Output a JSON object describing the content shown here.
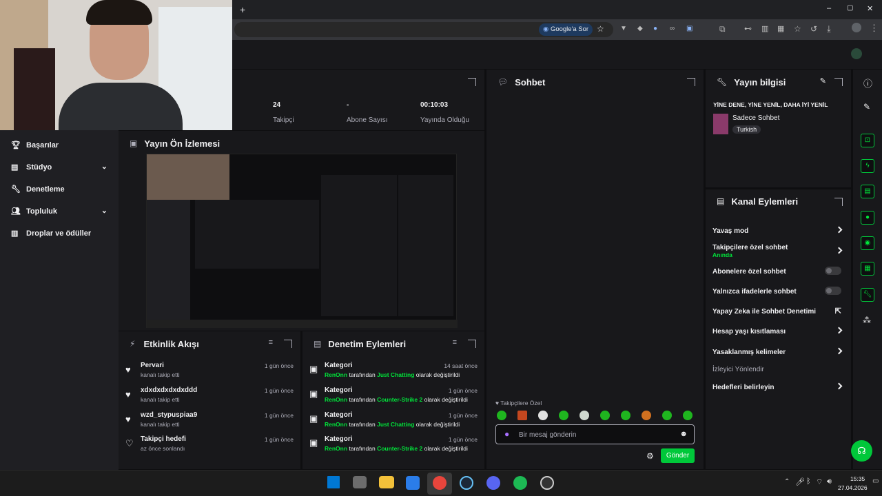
{
  "browser": {
    "new_tab": "+",
    "google_ask": "Google'a Sor",
    "win_min": "–",
    "win_max": "▢",
    "win_close": "✕"
  },
  "stats": {
    "followers_value": "24",
    "followers_label": "Takipçi",
    "subs_value": "-",
    "subs_label": "Abone Sayısı",
    "live_value": "00:10:03",
    "live_label": "Yayında Olduğu"
  },
  "nav": {
    "items": [
      {
        "label": "Başarılar",
        "icon": "trophy-icon"
      },
      {
        "label": "Stüdyo",
        "icon": "studio-icon",
        "expand": true
      },
      {
        "label": "Denetleme",
        "icon": "wrench-icon"
      },
      {
        "label": "Topluluk",
        "icon": "community-icon",
        "expand": true
      },
      {
        "label": "Droplar ve ödüller",
        "icon": "drops-icon"
      }
    ]
  },
  "preview": {
    "title": "Yayın Ön İzlemesi"
  },
  "activity": {
    "title": "Etkinlik Akışı",
    "items": [
      {
        "name": "Pervari",
        "sub": "kanalı takip etti",
        "when": "1 gün önce",
        "icon": "heart-icon"
      },
      {
        "name": "xdxdxdxdxdxddd",
        "sub": "kanalı takip etti",
        "when": "1 gün önce",
        "icon": "heart-icon"
      },
      {
        "name": "wzd_stypuspiaa9",
        "sub": "kanalı takip etti",
        "when": "1 gün önce",
        "icon": "heart-icon"
      },
      {
        "name": "Takipçi hedefi",
        "sub": "az önce sonlandı",
        "when": "1 gün önce",
        "icon": "heart-outline-icon"
      }
    ]
  },
  "modlog": {
    "title": "Denetim Eylemleri",
    "items": [
      {
        "title": "Kategori",
        "user": "RenOnn",
        "mid": "tarafından",
        "cat": "Just Chatting",
        "end": "olarak değiştirildi",
        "when": "14 saat önce"
      },
      {
        "title": "Kategori",
        "user": "RenOnn",
        "mid": "tarafından",
        "cat": "Counter-Strike 2",
        "end": "olarak değiştirildi",
        "when": "1 gün önce"
      },
      {
        "title": "Kategori",
        "user": "RenOnn",
        "mid": "tarafından",
        "cat": "Just Chatting",
        "end": "olarak değiştirildi",
        "when": "1 gün önce"
      },
      {
        "title": "Kategori",
        "user": "RenOnn",
        "mid": "tarafından",
        "cat": "Counter-Strike 2",
        "end": "olarak değiştirildi",
        "when": "1 gün önce"
      }
    ]
  },
  "chat": {
    "title": "Sohbet",
    "followers_only": "Takipçilere Özel",
    "placeholder": "Bir mesaj gönderin",
    "send": "Gönder"
  },
  "stream_info": {
    "title": "Yayın bilgisi",
    "stream_title": "YİNE DENE, YİNE YENİL, DAHA İYİ YENİL",
    "category": "Sadece Sohbet",
    "tag": "Turkish"
  },
  "channel_actions": {
    "title": "Kanal Eylemleri",
    "slow_mode": "Yavaş mod",
    "followers_chat": "Takipçilere özel sohbet",
    "followers_chat_sub": "Anında",
    "sub_chat": "Abonelere özel sohbet",
    "emote_chat": "Yalnızca ifadelerle sohbet",
    "ai_mod": "Yapay Zeka ile Sohbet Denetimi",
    "age_restrict": "Hesap yaşı kısıtlaması",
    "banned_words": "Yasaklanmış kelimeler",
    "viewer_redirect": "İzleyici Yönlendir",
    "set_goals": "Hedefleri belirleyin"
  },
  "taskbar": {
    "clock_time": "15:35",
    "clock_date": "27.04.2026"
  },
  "colors": {
    "accent": "#00e43a",
    "panel": "#18181b",
    "background": "#0e0e10"
  }
}
